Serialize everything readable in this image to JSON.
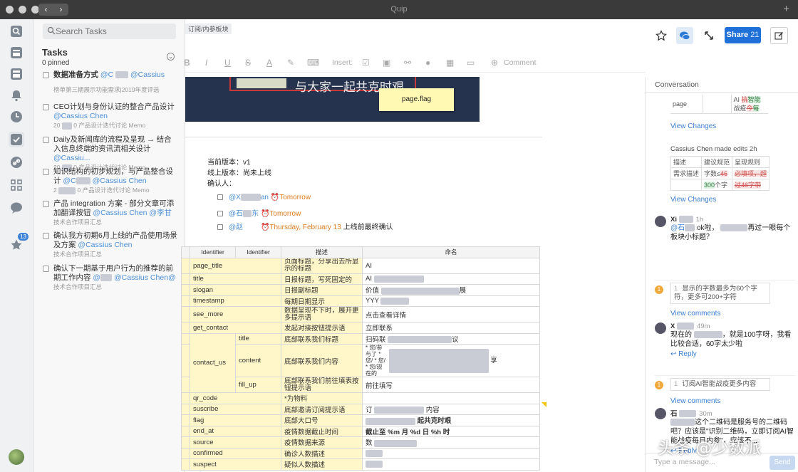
{
  "window": {
    "title": "Quip"
  },
  "rail": {
    "badge": "13"
  },
  "tasks": {
    "search_placeholder": "Search Tasks",
    "title": "Tasks",
    "pinned": "0 pinned",
    "items": [
      {
        "title": "数据准备方式",
        "mention": "@C",
        "mention2": "@Cassius",
        "sub": "榜单第三期展示功能需求|2019年度评选"
      },
      {
        "title": "CEO计划与身份认证的整合产品设计",
        "mention": "@Cassius Chen",
        "sub_num": "20",
        "sub": "0 产品设计迭代讨论 Memo"
      },
      {
        "title": "Daily及新闻库的流程及呈现 → 结合入信息终端的资讯流相关设计",
        "mention": "@Cassiu...",
        "sub_num": "20",
        "sub": "0 产品设计迭代讨论 Memo"
      },
      {
        "title": "知识结构的初步规划，与产品整合设计",
        "mention": "@C",
        "mention2": "@Cassius Chen",
        "sub_num": "2",
        "sub": "0 产品设计迭代讨论 Memo"
      },
      {
        "title": "产品 integration 方案 - 部分文章可添加翻译按钮",
        "mention": "@Cassius Chen",
        "mention2": "@李甘",
        "sub": "技术合作项目汇总"
      },
      {
        "title": "确认我方初期6月上线的产品使用场景及方案",
        "mention": "@Cassius Chen",
        "sub": "技术合作项目汇总"
      },
      {
        "title": "确认下一期基于用户行为的推荐的前期工作内容",
        "mention": "@",
        "mention2": "@Cassius Chen@",
        "sub": "技术合作项目汇总"
      }
    ]
  },
  "doc": {
    "breadcrumb": "订阅/内参板块",
    "share_label": "Share",
    "share_count": "21",
    "toolbar": {
      "insert": "Insert:",
      "comment": "Comment"
    },
    "banner_text": "与大家一起共克时艰",
    "flag_note": "page.flag",
    "meta": {
      "current_version": "当前版本：v1",
      "online_version": "线上版本：尚未上线",
      "confirmer": "确认人："
    },
    "checklist": [
      {
        "mention": "@X",
        "mention_tail": "an",
        "due": "Tomorrow",
        "note": ""
      },
      {
        "mention": "@石",
        "mention_tail": "东",
        "due": "Tomorrow",
        "note": ""
      },
      {
        "mention": "@赵",
        "mention_tail": "",
        "due": "Thursday, February 13",
        "note": "上线前最终确认"
      }
    ],
    "table": {
      "headers": [
        "Identifier",
        "Identifier",
        "描述",
        "命名"
      ],
      "rows": [
        {
          "id": "page_title",
          "sub": "",
          "desc": "页面标题，分享出去所显示的标题",
          "name": "AI"
        },
        {
          "id": "title",
          "sub": "",
          "desc": "日报标题，写死固定的",
          "name": "AI"
        },
        {
          "id": "slogan",
          "sub": "",
          "desc": "日报副标题",
          "name": "价值",
          "name_tail": "展"
        },
        {
          "id": "timestamp",
          "sub": "",
          "desc": "每期日期显示",
          "name": "YYY"
        },
        {
          "id": "see_more",
          "sub": "",
          "desc": "数据呈现不下时，展开更多提示语",
          "name": "点击查看详情"
        },
        {
          "id": "get_contact",
          "sub": "",
          "desc": "发起对接按钮提示语",
          "name": "立即联系"
        },
        {
          "id": "contact_us",
          "sub": "title",
          "desc": "底部联系我们标题",
          "name": "扫码联",
          "name_tail": "议"
        },
        {
          "id": "",
          "sub": "content",
          "desc": "底部联系我们内容",
          "name": "* 您/参与了 * 您/ * 您/ * 您/现在的",
          "name_tail": "享"
        },
        {
          "id": "",
          "sub": "fill_up",
          "desc": "底部联系我们前往填表按钮提示语",
          "name": "前往填写"
        },
        {
          "id": "qr_code",
          "sub": "",
          "desc": "*为物料",
          "name": ""
        },
        {
          "id": "suscribe",
          "sub": "",
          "desc": "底部邀请订阅提示语",
          "name": "订",
          "name_tail": "内容"
        },
        {
          "id": "flag",
          "sub": "",
          "desc": "底部大口号",
          "name": "",
          "name_tail": "起共克时艰"
        },
        {
          "id": "end_at",
          "sub": "",
          "desc": "疫情数据截止时间",
          "name": "截止至 %m 月 %d 日 %h 时"
        },
        {
          "id": "source",
          "sub": "",
          "desc": "疫情数据来源",
          "name": "数"
        },
        {
          "id": "confirmed",
          "sub": "",
          "desc": "确诊人数描述",
          "name": ""
        },
        {
          "id": "suspect",
          "sub": "",
          "desc": "疑似人数描述",
          "name": ""
        }
      ]
    }
  },
  "conversation": {
    "title": "Conversation",
    "edit1": {
      "left": "page",
      "right_a": "AI",
      "right_del": "抗",
      "right_ins": "智能",
      "right_b": "战疫",
      "right_del2": "今",
      "right_ins2": "每"
    },
    "view_changes": "View Changes",
    "edit2_author": "Cassius Chen",
    "edit2_text": "made edits",
    "edit2_time": "2h",
    "edit2_table": {
      "h1": "描述",
      "h2": "建议规范",
      "h3": "呈现规则",
      "r1c1": "需求描述",
      "r1c2": "字数≤",
      "r1c2_del": "46",
      "r1c3_del": "必填项，超",
      "r2c2_ins": "300",
      "r2c2": "个字",
      "r2c3_del": "过46字带"
    },
    "comment1": {
      "name": "Xi",
      "time": "1h",
      "mention": "@石",
      "text": "ok啦，",
      "text2": "再过一眼每个板块小标题？"
    },
    "quote1": {
      "num": "1",
      "text": "显示的字数最多为60个字符，更多可200+字符",
      "link": "View comments"
    },
    "comment2": {
      "name": "X",
      "time": "49m",
      "text": "现在的",
      "text2": "，就是100字呀，我看比较合适，60字太少啦",
      "reply": "Reply"
    },
    "quote2": {
      "num": "1",
      "text": "订阅AI智能战疫更多内容",
      "link": "View comments"
    },
    "comment3": {
      "name": "石",
      "time": "30m",
      "text": "这个二维码是服务号的二维码吧？应该是\"识别二维码，立即订阅AI智能战疫每日内参\"，应该不...",
      "reply": "Reply"
    },
    "input_placeholder": "Type a message...",
    "send": "Send"
  },
  "watermark": "头条 @少数派"
}
